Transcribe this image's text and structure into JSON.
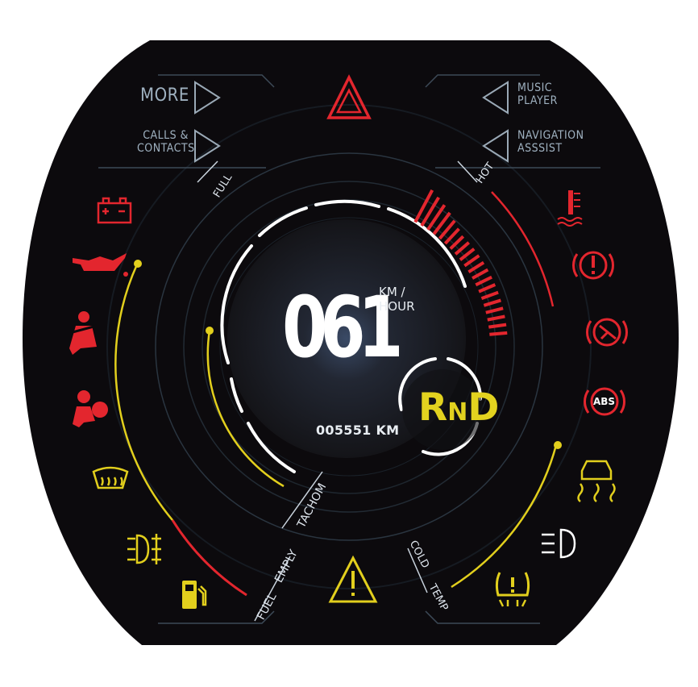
{
  "menu": {
    "more": "MORE",
    "calls_line1": "CALLS &",
    "calls_line2": "CONTACTS",
    "music_line1": "MUSIC",
    "music_line2": "PLAYER",
    "nav_line1": "NAVIGATION",
    "nav_line2": "ASSSIST"
  },
  "speed": {
    "value": "061",
    "unit_line1": "KM /",
    "unit_line2": "HOUR"
  },
  "odometer": "005551 KM",
  "gear": {
    "r": "R",
    "n": "N",
    "d": "D"
  },
  "gauges": {
    "full": "FULL",
    "hot": "HOT",
    "cold": "COLD",
    "temp": "TEMP",
    "fuel": "FUEL",
    "emply": "EMPLY",
    "tachom": "TACHOM"
  },
  "warnings": {
    "abs": "ABS"
  },
  "colors": {
    "background": "#0c0a0d",
    "accent_red": "#e3262e",
    "accent_yellow": "#e2cf1d",
    "text": "#c9d3dd",
    "line": "#3d4a57"
  },
  "icons_left": [
    "battery-icon",
    "oil-pressure-icon",
    "seatbelt-icon",
    "airbag-icon",
    "rear-defrost-icon",
    "fog-light-icon",
    "fuel-icon"
  ],
  "icons_right": [
    "coolant-temperature-icon",
    "brake-warning-icon",
    "parking-brake-icon",
    "abs-icon",
    "traction-control-icon",
    "headlight-icon",
    "tire-pressure-icon"
  ],
  "icons_center": [
    "hazard-icon",
    "warning-icon"
  ]
}
